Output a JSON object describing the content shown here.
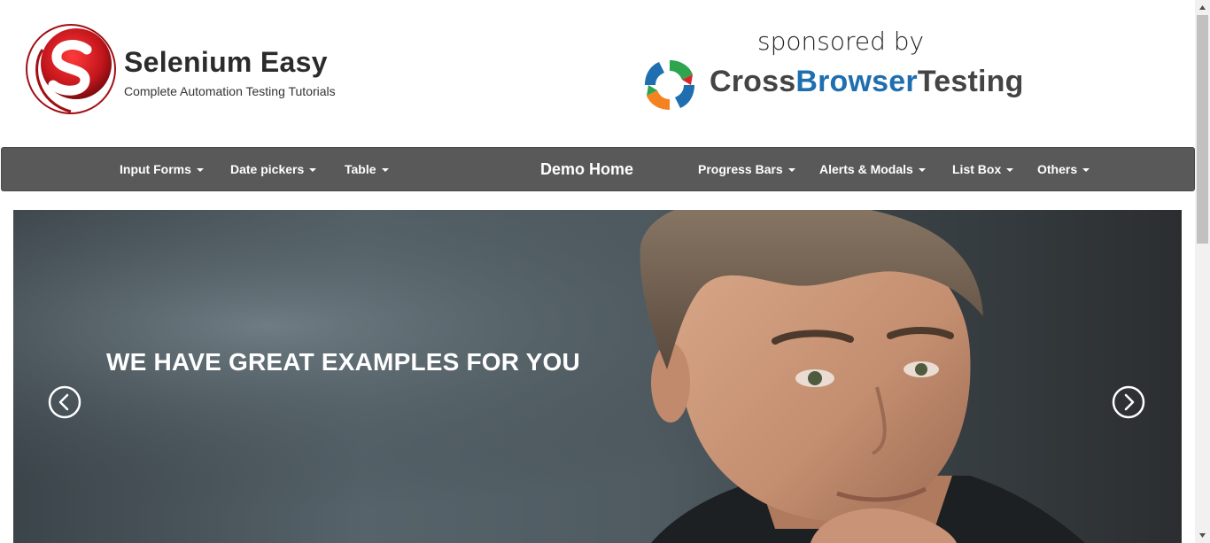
{
  "header": {
    "site_title": "Selenium Easy",
    "tagline": "Complete Automation Testing Tutorials",
    "sponsor_label": "sponsored by",
    "sponsor_name_part1": "Cross",
    "sponsor_name_part2": "Browser",
    "sponsor_name_part3": "Testing"
  },
  "nav": {
    "items": [
      {
        "label": "Input Forms"
      },
      {
        "label": "Date pickers"
      },
      {
        "label": "Table"
      },
      {
        "label": "Demo Home"
      },
      {
        "label": "Progress Bars"
      },
      {
        "label": "Alerts & Modals"
      },
      {
        "label": "List Box"
      },
      {
        "label": "Others"
      }
    ]
  },
  "carousel": {
    "caption": "WE HAVE GREAT EXAMPLES FOR YOU",
    "prev_icon": "chevron-left-icon",
    "next_icon": "chevron-right-icon"
  },
  "colors": {
    "navbar": "#595959",
    "brand_red": "#c4161c",
    "sponsor_blue": "#1f6fb0"
  }
}
